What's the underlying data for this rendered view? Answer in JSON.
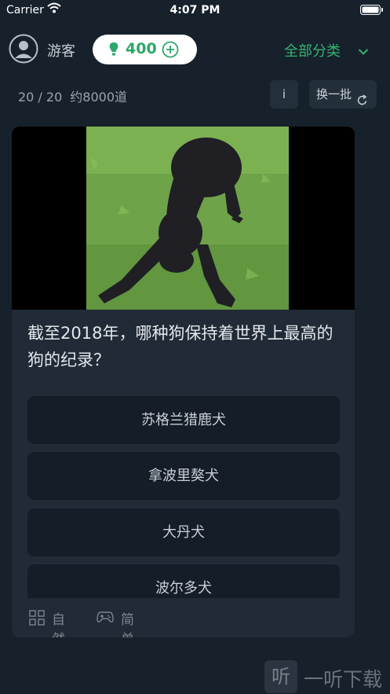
{
  "status_bar": {
    "carrier": "Carrier",
    "time": "4:07 PM"
  },
  "header": {
    "guest_label": "游客",
    "coins": "400",
    "category_label": "全部分类"
  },
  "subbar": {
    "progress": "20 / 20",
    "question_count": "约8000道",
    "info_label": "i",
    "swap_label": "换一批"
  },
  "question": {
    "text": "截至2018年，哪种狗保持着世界上最高的狗的纪录？",
    "options": [
      "苏格兰猎鹿犬",
      "拿波里獒犬",
      "大丹犬",
      "波尔多犬"
    ],
    "tags": {
      "category": "自然",
      "difficulty": "简单"
    }
  },
  "watermark": {
    "icon_glyph": "听",
    "text": "一听下载"
  },
  "colors": {
    "background": "#16212c",
    "card": "#202b37",
    "option_bg": "#141d28",
    "accent_green": "#35b46f",
    "coin_green": "#2ba86a"
  },
  "icons": [
    "wifi-icon",
    "battery-icon",
    "avatar-icon",
    "bulb-icon",
    "plus-icon",
    "chevron-down-icon",
    "refresh-icon",
    "grid-icon",
    "gamepad-icon"
  ]
}
